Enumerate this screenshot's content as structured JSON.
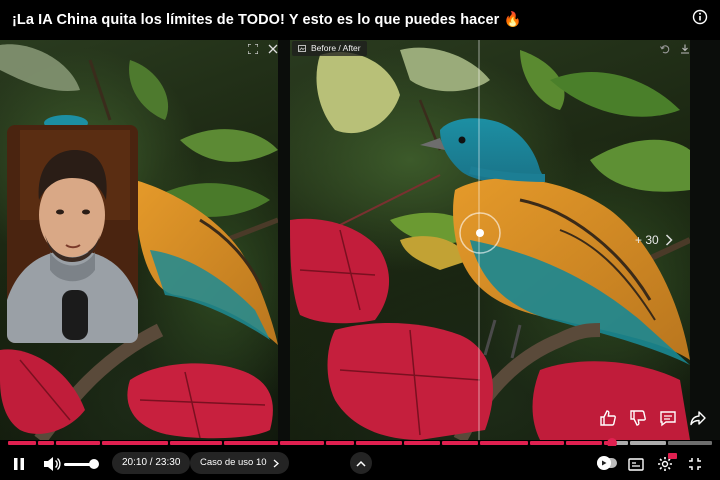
{
  "header": {
    "title": "¡La IA China quita los límites de TODO! Y esto es lo que puedes hacer",
    "title_emoji": "🔥",
    "info_icon": "info-icon"
  },
  "compare": {
    "label": "Before / After",
    "icons": [
      "fullscreen-icon",
      "close-icon",
      "undo-icon",
      "download-icon"
    ]
  },
  "overlay": {
    "skip_label": "+ 30",
    "reactions": [
      "thumbs-up-icon",
      "thumbs-down-icon",
      "comment-icon",
      "share-icon"
    ]
  },
  "player": {
    "current_time": "20:10",
    "separator": " / ",
    "duration": "23:30",
    "chapter_label": "Caso de uso 10",
    "progress_fraction": 0.858,
    "volume_fraction": 0.85,
    "colors": {
      "accent": "#e02050",
      "panel": "#282828"
    }
  }
}
